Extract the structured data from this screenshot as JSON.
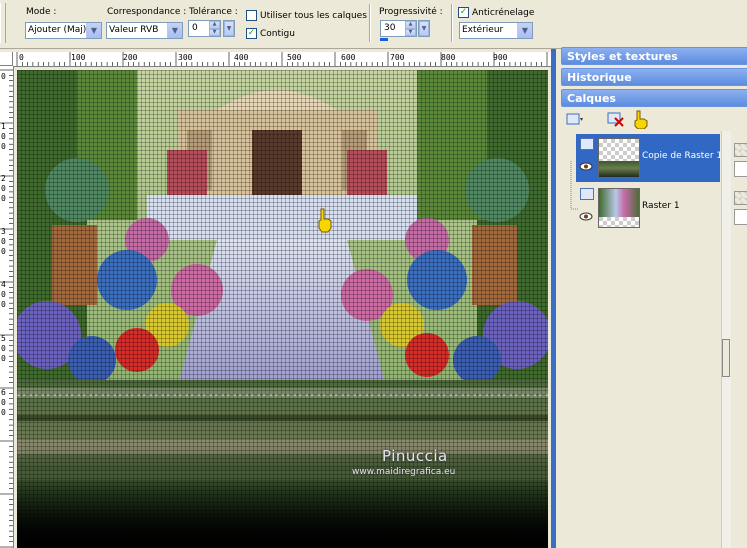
{
  "toolbar": {
    "mode_label": "Mode :",
    "mode_value": "Ajouter (Maj)",
    "match_label": "Correspondance :",
    "match_value": "Valeur RVB",
    "tolerance_label": "Tolérance :",
    "tolerance_value": "0",
    "use_all_layers_label": "Utiliser tous les calques",
    "contiguous_label": "Contigu",
    "contiguous_checked": true,
    "use_all_layers_checked": false,
    "feather_label": "Progressivité :",
    "feather_value": "30",
    "antialias_label": "Anticrénelage",
    "antialias_checked": true,
    "antialias_mode_value": "Extérieur"
  },
  "rulers": {
    "top_ticks": [
      "0",
      "100",
      "200",
      "300",
      "400",
      "500",
      "600",
      "700",
      "800",
      "900"
    ],
    "left_ticks": [
      "0",
      "1 0 0",
      "2 0 0",
      "3 0 0",
      "4 0 0",
      "5 0 0",
      "6 0 0"
    ]
  },
  "canvas": {
    "watermark_title": "Pinuccia",
    "watermark_url": "www.maidiregrafica.eu"
  },
  "panels": {
    "styles_title": "Styles et textures",
    "history_title": "Historique",
    "layers_title": "Calques"
  },
  "layers": [
    {
      "name": "Copie de Raster 1",
      "selected": true
    },
    {
      "name": "Raster 1",
      "selected": false
    }
  ],
  "colors": {
    "panel_header": "#6a93df",
    "selection": "#3168c4",
    "window_frame": "#3a6ec4",
    "face": "#ece9d8"
  }
}
